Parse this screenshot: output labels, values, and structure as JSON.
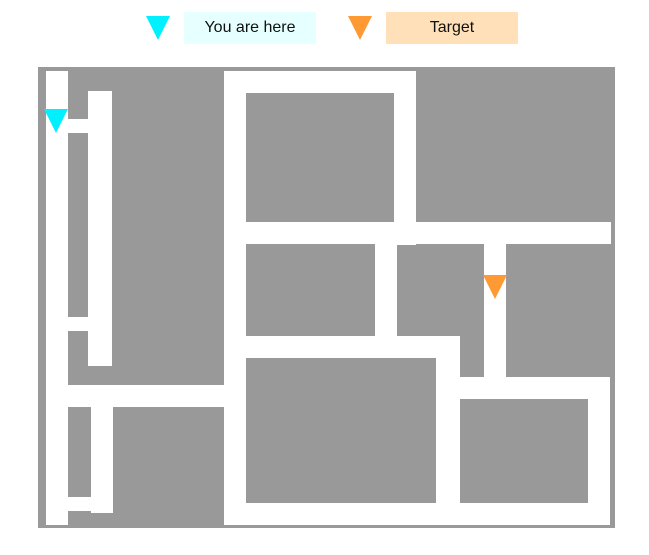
{
  "legend": {
    "you_are_here": {
      "label": "You are here",
      "marker_color": "#00f0ff",
      "icon": "inverted-triangle"
    },
    "target": {
      "label": "Target",
      "marker_color": "#ff9933",
      "icon": "inverted-triangle"
    }
  },
  "map": {
    "block_color": "#999999",
    "path_color": "#ffffff"
  }
}
